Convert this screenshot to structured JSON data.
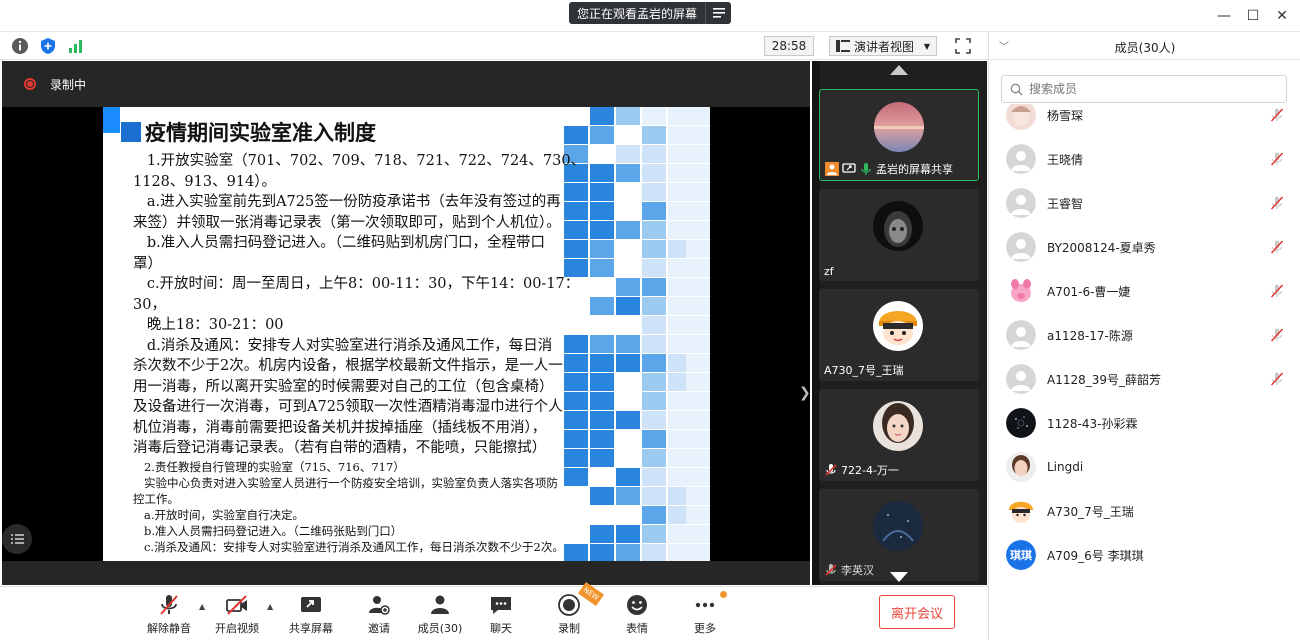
{
  "window": {
    "share_notice": "您正在观看孟岩的屏幕",
    "minimize": "—",
    "maximize": "☐",
    "close": "✕"
  },
  "toolbar": {
    "timer": "28:58",
    "view_label": "演讲者视图"
  },
  "stage": {
    "recording_label": "录制中"
  },
  "slide": {
    "title": "疫情期间实验室准入制度",
    "lines": [
      {
        "text": "   1.开放实验室（701、702、709、718、721、722、724、730、",
        "small": false
      },
      {
        "text": "1128、913、914）。",
        "small": false
      },
      {
        "text": "   a.进入实验室前先到A725签一份防疫承诺书（去年没有签过的再",
        "small": false
      },
      {
        "text": "来签）并领取一张消毒记录表（第一次领取即可，贴到个人机位）。",
        "small": false
      },
      {
        "text": "   b.准入人员需扫码登记进入。（二维码贴到机房门口，全程带口",
        "small": false
      },
      {
        "text": "罩）",
        "small": false
      },
      {
        "text": "   c.开放时间：周一至周日，上午8：00-11：30，下午14：00-17：",
        "small": false
      },
      {
        "text": "30，",
        "small": false
      },
      {
        "text": "   晚上18：30-21：00",
        "small": false
      },
      {
        "text": "   d.消杀及通风：安排专人对实验室进行消杀及通风工作，每日消",
        "small": false
      },
      {
        "text": "杀次数不少于2次。机房内设备，根据学校最新文件指示，是一人一",
        "small": false
      },
      {
        "text": "用一消毒，所以离开实验室的时候需要对自己的工位（包含桌椅）",
        "small": false
      },
      {
        "text": "及设备进行一次消毒，可到A725领取一次性酒精消毒湿巾进行个人",
        "small": false
      },
      {
        "text": "机位消毒，消毒前需要把设备关机并拔掉插座（插线板不用消），",
        "small": false
      },
      {
        "text": "消毒后登记消毒记录表。（若有自带的酒精，不能喷，只能擦拭）",
        "small": false
      },
      {
        "text": "   2.责任教授自行管理的实验室（715、716、717）",
        "small": true
      },
      {
        "text": "   实验中心负责对进入实验室人员进行一个防疫安全培训，实验室负责人落实各项防",
        "small": true
      },
      {
        "text": "控工作。",
        "small": true
      },
      {
        "text": "   a.开放时间，实验室自行决定。",
        "small": true
      },
      {
        "text": "   b.准入人员需扫码登记进入。（二维码张贴到门口）",
        "small": true
      },
      {
        "text": "   c.消杀及通风：安排专人对实验室进行消杀及通风工作，每日消杀次数不少于2次。",
        "small": true
      }
    ]
  },
  "gallery": [
    {
      "name": "孟岩的屏幕共享",
      "active": true
    },
    {
      "name": "zf",
      "active": false
    },
    {
      "name": "A730_7号_王瑞",
      "active": false
    },
    {
      "name": "722-4-万一",
      "active": false
    },
    {
      "name": "李英汉",
      "active": false
    }
  ],
  "bottombar": {
    "unmute": "解除静音",
    "start_video": "开启视频",
    "share_screen": "共享屏幕",
    "invite": "邀请",
    "members": "成员(30)",
    "chat": "聊天",
    "record": "录制",
    "reactions": "表情",
    "more": "更多",
    "leave": "离开会议",
    "new_badge": "NEW"
  },
  "panel": {
    "title": "成员(30人)",
    "search_placeholder": "搜索成员",
    "members": [
      {
        "name": "杨雪琛",
        "avatar": "photo-pink"
      },
      {
        "name": "王晓倩",
        "avatar": "default"
      },
      {
        "name": "王睿智",
        "avatar": "default"
      },
      {
        "name": "BY2008124-夏卓秀",
        "avatar": "default"
      },
      {
        "name": "A701-6-曹一婕",
        "avatar": "pink-pig"
      },
      {
        "name": "a1128-17-陈源",
        "avatar": "default"
      },
      {
        "name": "A1128_39号_薛韶芳",
        "avatar": "default"
      },
      {
        "name": "1128-43-孙彩霖",
        "avatar": "dark"
      },
      {
        "name": "Lingdi",
        "avatar": "photo-face"
      },
      {
        "name": "A730_7号_王瑞",
        "avatar": "cartoon"
      },
      {
        "name": "A709_6号 李琪琪",
        "avatar": "text",
        "avatar_text": "琪琪"
      }
    ]
  },
  "colors": {
    "accent_blue": "#1a8cff",
    "leave_red": "#e8473c",
    "record_red": "#e0392f",
    "active_green": "#2bbb5c",
    "badge_orange": "#f0942d"
  }
}
